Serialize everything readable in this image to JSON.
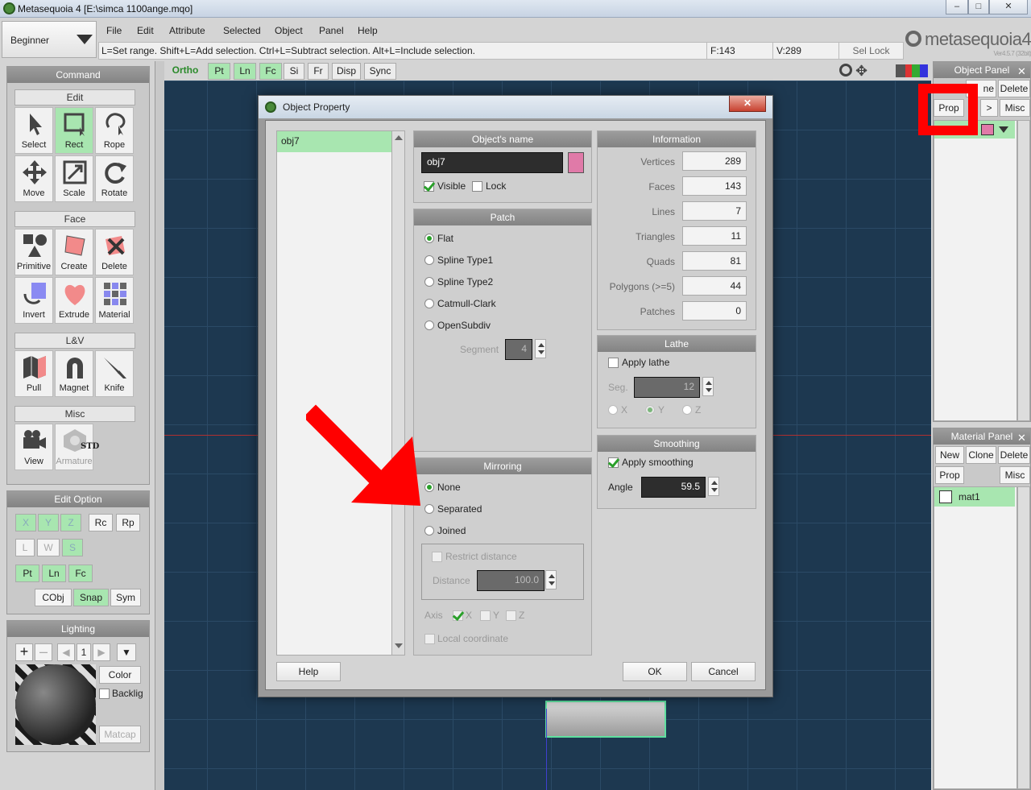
{
  "window": {
    "title": "Metasequoia 4 [E:\\simca 1100ange.mqo]"
  },
  "mode": {
    "label": "Beginner"
  },
  "menu": [
    "File",
    "Edit",
    "Attribute",
    "Selected",
    "Object",
    "Panel",
    "Help"
  ],
  "status": {
    "hint": "L=Set range.  Shift+L=Add selection.  Ctrl+L=Subtract selection.  Alt+L=Include selection.",
    "faces": "F:143",
    "vertices": "V:289",
    "sel_lock": "Sel Lock"
  },
  "logo": {
    "name": "metasequoia4",
    "version": "Ver4.5.7 (32bit)"
  },
  "view_toolbar": {
    "ortho": "Ortho",
    "buttons": [
      "Pt",
      "Ln",
      "Fc",
      "Si",
      "Fr",
      "Disp",
      "Sync"
    ]
  },
  "command_panel": {
    "title": "Command",
    "edit": {
      "title": "Edit",
      "tools": [
        "Select",
        "Rect",
        "Rope",
        "Move",
        "Scale",
        "Rotate"
      ]
    },
    "face": {
      "title": "Face",
      "tools": [
        "Primitive",
        "Create",
        "Delete",
        "Invert",
        "Extrude",
        "Material"
      ]
    },
    "lv": {
      "title": "L&V",
      "tools": [
        "Pull",
        "Magnet",
        "Knife"
      ]
    },
    "misc": {
      "title": "Misc",
      "tools": [
        "View",
        "Armature"
      ],
      "std": "STD"
    }
  },
  "edit_option": {
    "title": "Edit Option",
    "axes": [
      "X",
      "Y",
      "Z"
    ],
    "rc": "Rc",
    "rp": "Rp",
    "lws": [
      "L",
      "W",
      "S"
    ],
    "sel": [
      "Pt",
      "Ln",
      "Fc"
    ],
    "cobj": "CObj",
    "snap": "Snap",
    "sym": "Sym"
  },
  "lighting": {
    "title": "Lighting",
    "count": "1",
    "color": "Color",
    "backlight": "Backlig",
    "matcap": "Matcap"
  },
  "dialog": {
    "title": "Object Property",
    "object_list": [
      "obj7"
    ],
    "name_group": {
      "title": "Object's name",
      "name": "obj7",
      "color": "#e07aa8",
      "visible": "Visible",
      "lock": "Lock"
    },
    "patch": {
      "title": "Patch",
      "options": [
        "Flat",
        "Spline Type1",
        "Spline Type2",
        "Catmull-Clark",
        "OpenSubdiv"
      ],
      "segment_label": "Segment",
      "segment": "4"
    },
    "mirroring": {
      "title": "Mirroring",
      "options": [
        "None",
        "Separated",
        "Joined"
      ],
      "restrict": "Restrict distance",
      "distance_label": "Distance",
      "distance": "100.0",
      "axis_label": "Axis",
      "axes": [
        "X",
        "Y",
        "Z"
      ],
      "local": "Local coordinate"
    },
    "information": {
      "title": "Information",
      "rows": [
        {
          "label": "Vertices",
          "value": "289"
        },
        {
          "label": "Faces",
          "value": "143"
        },
        {
          "label": "Lines",
          "value": "7"
        },
        {
          "label": "Triangles",
          "value": "11"
        },
        {
          "label": "Quads",
          "value": "81"
        },
        {
          "label": "Polygons (>=5)",
          "value": "44"
        },
        {
          "label": "Patches",
          "value": "0"
        }
      ]
    },
    "lathe": {
      "title": "Lathe",
      "apply": "Apply lathe",
      "seg_label": "Seg.",
      "seg": "12",
      "axes": [
        "X",
        "Y",
        "Z"
      ]
    },
    "smoothing": {
      "title": "Smoothing",
      "apply": "Apply smoothing",
      "angle_label": "Angle",
      "angle": "59.5"
    },
    "help": "Help",
    "ok": "OK",
    "cancel": "Cancel"
  },
  "object_panel": {
    "title": "Object Panel",
    "new_partial": "ne",
    "delete": "Delete",
    "prop": "Prop",
    "arrow": ">",
    "misc": "Misc"
  },
  "material_panel": {
    "title": "Material Panel",
    "new": "New",
    "clone": "Clone",
    "delete": "Delete",
    "prop": "Prop",
    "misc": "Misc",
    "items": [
      "mat1"
    ]
  },
  "colors": {
    "accent_green": "#a8e6b0",
    "annotation_red": "#ff0000",
    "viewport": "#1d3850"
  }
}
